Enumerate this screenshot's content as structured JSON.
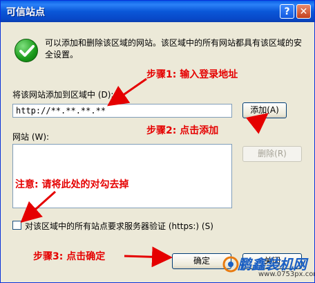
{
  "window": {
    "title": "可信站点",
    "help_glyph": "?",
    "close_glyph": "✕"
  },
  "description": "可以添加和删除该区域的网站。该区域中的所有网站都具有该区域的安全设置。",
  "add_section": {
    "label": "将该网站添加到区域中 (D):",
    "input_value": "http://**.**.**.**",
    "add_button": "添加(A)"
  },
  "sites_section": {
    "label": "网站 (W):",
    "remove_button": "删除(R)"
  },
  "verify": {
    "label": "对该区域中的所有站点要求服务器验证 (https:) (S)",
    "checked": false
  },
  "buttons": {
    "ok": "确定",
    "close": "关闭"
  },
  "annotations": {
    "step1": "步骤1: 输入登录地址",
    "step2": "步骤2: 点击添加",
    "note": "注意: 请将此处的对勾去掉",
    "step3": "步骤3: 点击确定"
  },
  "watermark": {
    "brand": "鹏鑫装机网",
    "url": "www.0753px.com"
  },
  "colors": {
    "annotation": "#e50000",
    "titlebar": "#0a57d8",
    "watermark": "#1a5fc4"
  }
}
